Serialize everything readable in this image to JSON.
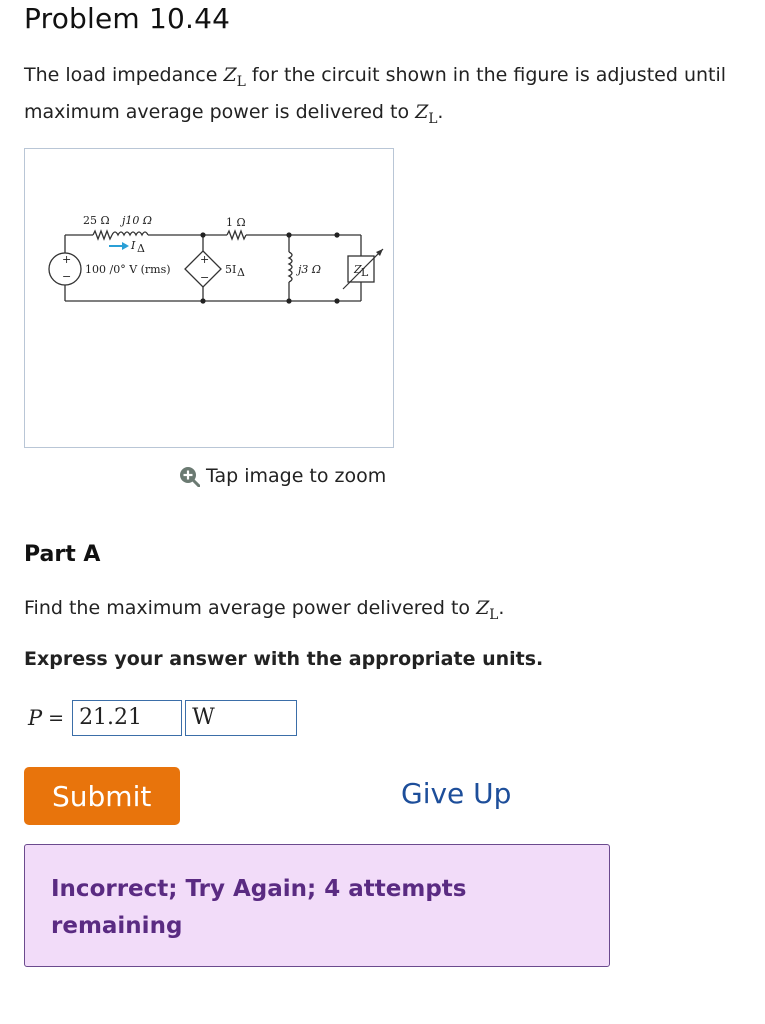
{
  "problem": {
    "title": "Problem 10.44",
    "intro_before": "The load impedance",
    "intro_middle": "for the circuit shown in the figure is adjusted until maximum average power is delivered to",
    "intro_end": "."
  },
  "symbols": {
    "z_main": "Z",
    "z_sub": "L",
    "p_var": "P"
  },
  "figure": {
    "labels": {
      "r1": "25 Ω",
      "l1": "j10 Ω",
      "r2": "1 Ω",
      "source": "100 /0° V (rms)",
      "current": "I",
      "current_sub": "Δ",
      "dep_source": "5I",
      "dep_sub": "Δ",
      "l2": "j3 Ω",
      "load": "Z",
      "load_sub": "L",
      "plus": "+",
      "minus": "−"
    },
    "zoom_text": "Tap image to zoom",
    "zoom_icon": "zoom-plus-icon"
  },
  "part_a": {
    "title": "Part A",
    "question_before": "Find the maximum average power delivered to",
    "question_end": ".",
    "instruction": "Express your answer with the appropriate units.",
    "equals": "=",
    "value": "21.21",
    "unit": "W"
  },
  "actions": {
    "submit_label": "Submit",
    "giveup_label": "Give Up"
  },
  "feedback": {
    "message": "Incorrect; Try Again; 4 attempts remaining"
  },
  "colors": {
    "submit": "#e8740c",
    "link": "#1d4e9a",
    "feedback_bg": "#f2dcf9",
    "feedback_text": "#5a2b82",
    "field_border": "#3b6ea8",
    "current_arrow": "#2a9fd6"
  }
}
